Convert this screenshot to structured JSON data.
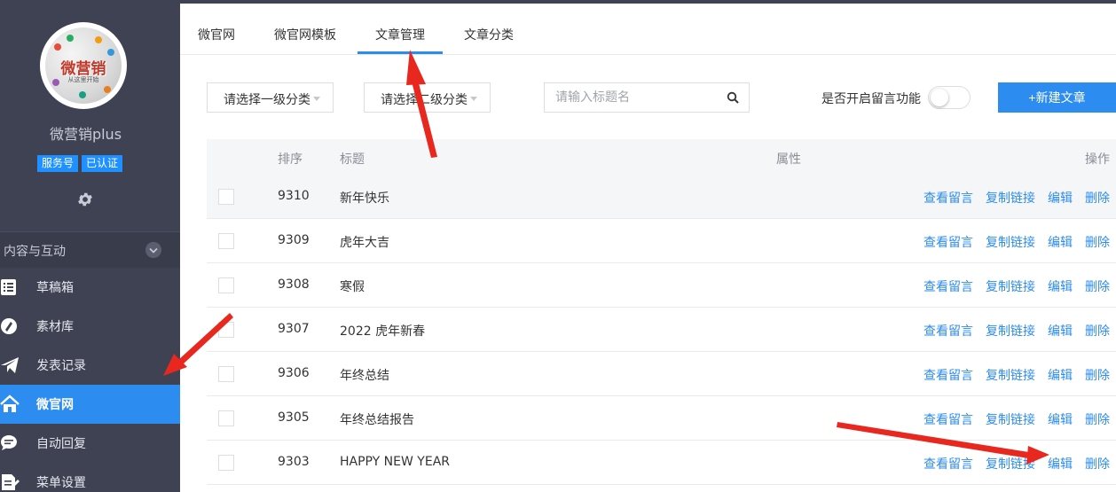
{
  "sidebar": {
    "avatar_text": "微营销",
    "avatar_sub": "从这里开始",
    "account_name": "微营销plus",
    "badges": [
      "服务号",
      "已认证"
    ],
    "section_title": "内容与互动",
    "items": [
      {
        "label": "草稿箱",
        "icon": "draft-icon"
      },
      {
        "label": "素材库",
        "icon": "material-icon"
      },
      {
        "label": "发表记录",
        "icon": "send-icon"
      },
      {
        "label": "微官网",
        "icon": "home-icon",
        "active": true
      },
      {
        "label": "自动回复",
        "icon": "chat-icon"
      },
      {
        "label": "菜单设置",
        "icon": "menu-doc-icon"
      }
    ]
  },
  "tabs": [
    "微官网",
    "微官网模板",
    "文章管理",
    "文章分类"
  ],
  "active_tab": "文章管理",
  "filters": {
    "category1": "请选择一级分类",
    "category2": "请选择二级分类",
    "search_placeholder": "请输入标题名",
    "comment_toggle_label": "是否开启留言功能",
    "comment_toggle_on": false,
    "new_button": "+新建文章"
  },
  "table": {
    "headers": {
      "order": "排序",
      "title": "标题",
      "attr": "属性",
      "ops": "操作"
    },
    "actions": {
      "view": "查看留言",
      "copy": "复制链接",
      "edit": "编辑",
      "delete": "删除"
    },
    "rows": [
      {
        "order": "9310",
        "title": "新年快乐"
      },
      {
        "order": "9309",
        "title": "虎年大吉"
      },
      {
        "order": "9308",
        "title": "寒假"
      },
      {
        "order": "9307",
        "title": "2022 虎年新春"
      },
      {
        "order": "9306",
        "title": "年终总结"
      },
      {
        "order": "9305",
        "title": "年终总结报告"
      },
      {
        "order": "9303",
        "title": "HAPPY NEW YEAR"
      }
    ]
  },
  "colors": {
    "accent": "#2d8cf0",
    "sidebar": "#3e4253",
    "annotation": "#e8281e"
  }
}
